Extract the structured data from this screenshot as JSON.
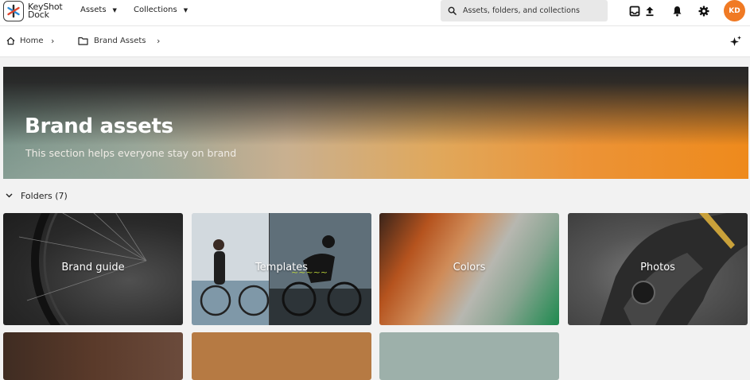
{
  "app": {
    "logo_line1": "KeyShot",
    "logo_line2": "Dock"
  },
  "topnav": {
    "assets_label": "Assets",
    "collections_label": "Collections"
  },
  "search": {
    "placeholder": "Assets, folders, and collections"
  },
  "user": {
    "initials": "KD",
    "avatar_color": "#f07a24"
  },
  "breadcrumb": {
    "home_label": "Home",
    "folder_label": "Brand Assets"
  },
  "hero": {
    "title": "Brand assets",
    "subtitle": "This section helps everyone stay on brand"
  },
  "folders": {
    "header": "Folders (7)",
    "items": [
      {
        "label": "Brand guide"
      },
      {
        "label": "Templates"
      },
      {
        "label": "Colors"
      },
      {
        "label": "Photos"
      },
      {
        "label": ""
      },
      {
        "label": ""
      },
      {
        "label": ""
      }
    ]
  },
  "icons": {
    "logo": "keyshot-logo-icon",
    "search": "search-icon",
    "inbox": "inbox-icon",
    "upload": "upload-icon",
    "notifications": "bell-icon",
    "settings": "gear-icon",
    "home": "home-icon",
    "folder": "folder-icon",
    "ai": "sparkle-icon"
  }
}
